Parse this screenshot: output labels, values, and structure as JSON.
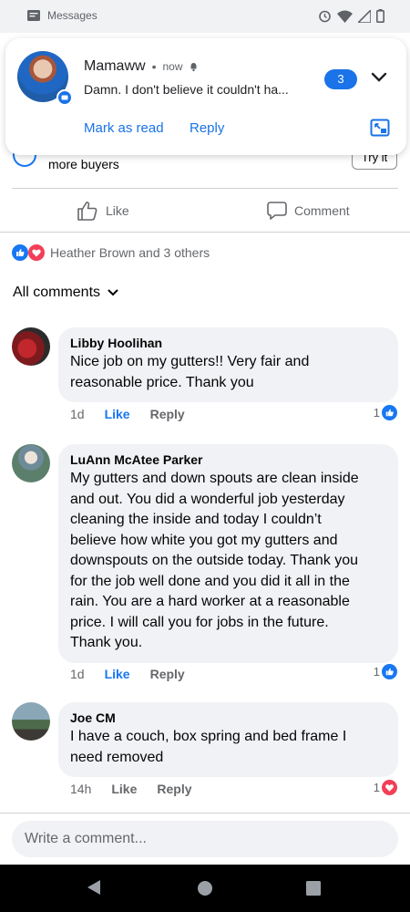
{
  "status_bar": {
    "notification_label": "Messages",
    "icons": [
      "messages-icon",
      "alarm-icon",
      "wifi-icon",
      "signal-icon",
      "battery-icon"
    ]
  },
  "notification": {
    "sender": "Mamaww",
    "separator": "•",
    "time": "now",
    "message": "Damn. I don't believe it couldn't ha...",
    "count": "3",
    "mark_read_label": "Mark as read",
    "reply_label": "Reply",
    "accent_color": "#1a73e8"
  },
  "post": {
    "peek_text": "more buyers",
    "peek_button": "Try it",
    "like_label": "Like",
    "comment_label": "Comment",
    "reactions_text": "Heather Brown and 3 others",
    "all_comments_label": "All comments"
  },
  "comments": [
    {
      "name": "Libby Hoolihan",
      "lines": [
        "Nice job on my gutters!! Very fair and",
        "reasonable price. Thank you"
      ],
      "time": "1d",
      "like": "Like",
      "reply": "Reply",
      "reaction_count": "1",
      "reaction": "like"
    },
    {
      "name": "LuAnn McAtee Parker",
      "lines": [
        "My gutters and down spouts are clean inside",
        "and out. You did a wonderful job yesterday",
        "cleaning the inside and today I couldn’t",
        "believe how white you got my gutters and",
        "downspouts on the outside today. Thank you",
        "for the job well done and you did it all in the",
        "rain. You are a hard worker at a reasonable",
        "price. I will call you for jobs in the future.",
        "Thank you."
      ],
      "time": "1d",
      "like": "Like",
      "reply": "Reply",
      "reaction_count": "1",
      "reaction": "like"
    },
    {
      "name": "Joe CM",
      "lines": [
        "I have a couch, box spring and bed frame I",
        "need removed"
      ],
      "time": "14h",
      "like": "Like",
      "reply": "Reply",
      "reaction_count": "1",
      "reaction": "love"
    }
  ],
  "composer": {
    "placeholder": "Write a comment..."
  },
  "colors": {
    "facebook_blue": "#1877f2",
    "love_red": "#f33e58",
    "bubble_gray": "#f0f2f5"
  }
}
